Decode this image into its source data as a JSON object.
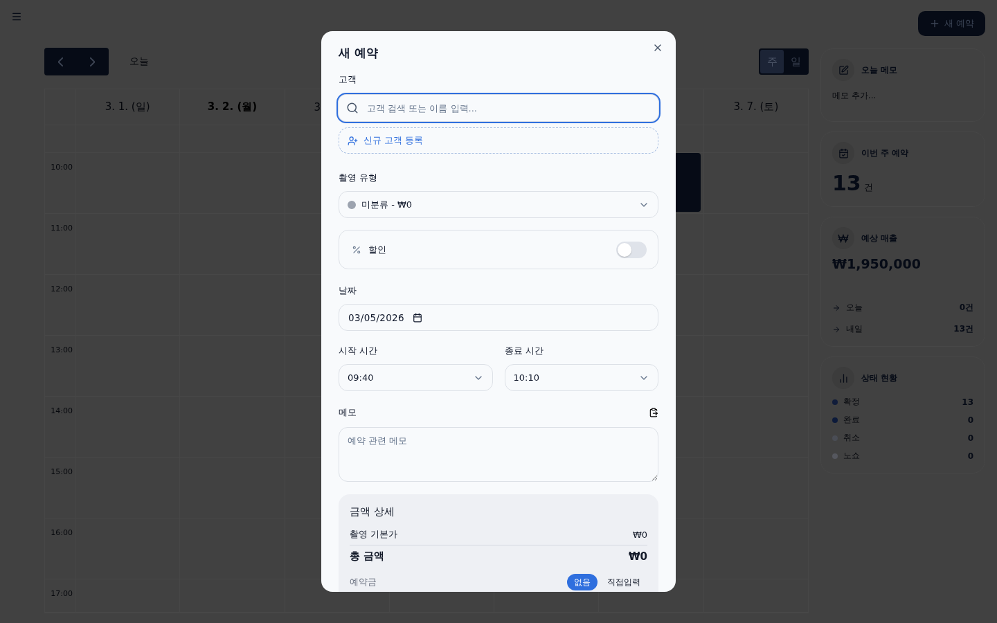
{
  "header": {
    "new_button": "새 예약"
  },
  "toolbar": {
    "today": "오늘",
    "views": [
      {
        "label": "주",
        "selected": true
      },
      {
        "label": "일",
        "selected": false
      }
    ]
  },
  "calendar": {
    "columns": [
      {
        "label": "3. 1. (일)",
        "today": false
      },
      {
        "label": "3. 2. (월)",
        "today": true
      },
      {
        "label": "3",
        "today": false
      },
      {},
      {},
      {
        "has_event": true
      },
      {
        "label": "3. 7. (토)",
        "today": false
      }
    ],
    "times": [
      "10:00",
      "11:00",
      "12:00",
      "13:00",
      "14:00",
      "15:00",
      "16:00",
      "17:00"
    ]
  },
  "sidebar": {
    "memo": {
      "title": "오늘 메모",
      "placeholder": "메모 추가..."
    },
    "week": {
      "title": "이번 주 예약",
      "count": "13",
      "unit": "건"
    },
    "revenue": {
      "title": "예상 매출",
      "amount": "₩1,950,000",
      "rows": [
        {
          "label": "오늘",
          "value": "0건"
        },
        {
          "label": "내일",
          "value": "13건"
        }
      ]
    },
    "status": {
      "title": "상태 현황",
      "items": [
        {
          "label": "확정",
          "value": "13",
          "color": "#101c3a"
        },
        {
          "label": "완료",
          "value": "0",
          "color": "#0c1a3a"
        },
        {
          "label": "취소",
          "value": "0",
          "color": "#4a4d55"
        },
        {
          "label": "노쇼",
          "value": "0",
          "color": "#55575e"
        }
      ]
    }
  },
  "modal": {
    "title": "새 예약",
    "customer": {
      "label": "고객",
      "placeholder": "고객 검색 또는 이름 입력...",
      "new_button": "신규 고객 등록"
    },
    "type": {
      "label": "촬영 유형",
      "value": "미분류 - ₩0",
      "color": "#9ca3af"
    },
    "discount": {
      "label": "할인",
      "on": false
    },
    "date": {
      "label": "날짜",
      "value": "03/05/2026"
    },
    "start": {
      "label": "시작 시간",
      "value": "09:40"
    },
    "end": {
      "label": "종료 시간",
      "value": "10:10"
    },
    "memo": {
      "label": "메모",
      "placeholder": "예약 관련 메모"
    },
    "price": {
      "title": "금액 상세",
      "base_label": "촬영 기본가",
      "base_value": "₩0",
      "total_label": "총 금액",
      "total_value": "₩0",
      "deposit_label": "예약금",
      "deposit_options": [
        {
          "label": "없음",
          "selected": true
        },
        {
          "label": "직접입력",
          "selected": false
        }
      ]
    }
  }
}
